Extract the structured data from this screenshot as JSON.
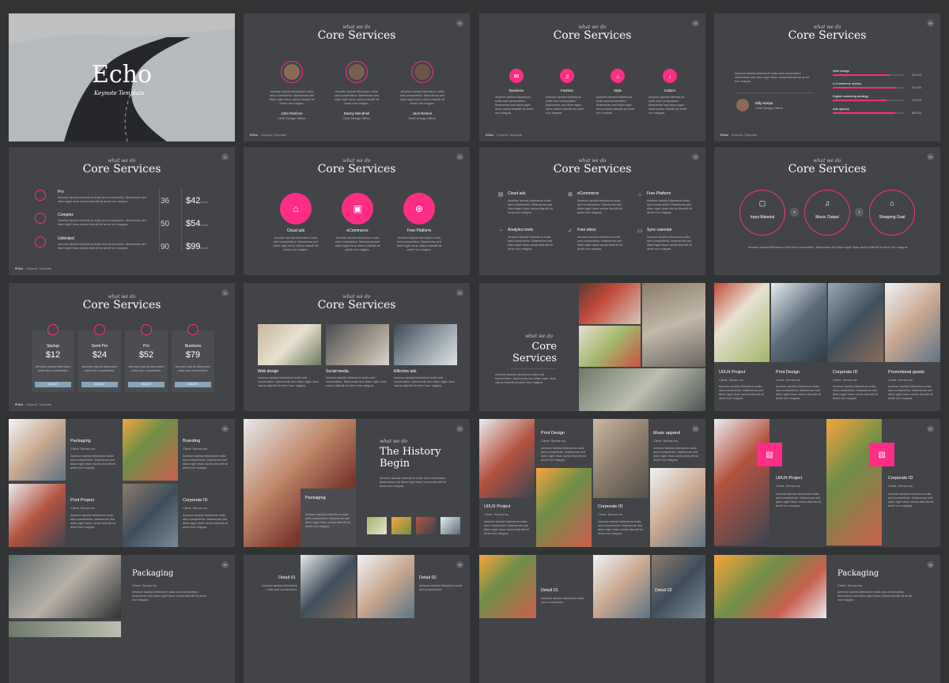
{
  "common": {
    "kicker": "what we do",
    "core_services": "Core Services",
    "footer_brand": "Echo",
    "footer_sub": "Keynote Template",
    "lorem": "Aenean lacinia bibendum nulla sed consectetur. Maecenas sed diam eget risus varius blandit sit amet non magna.",
    "lorem_short": "Aenean lacinia bibendum nulla sed consectetur.",
    "client": "Client: Somos inc."
  },
  "s1": {
    "title": "Echo",
    "subtitle": "Keynote Template"
  },
  "s2": {
    "page": "04",
    "people": [
      {
        "name": "John Reslone",
        "role": "Chief Design Officer"
      },
      {
        "name": "Danny Mendhell",
        "role": "Chief Design Officer"
      },
      {
        "name": "Jack Reston",
        "role": "Chief Design Officer"
      }
    ]
  },
  "s3": {
    "page": "05",
    "items": [
      "Business",
      "Fashion",
      "Style",
      "Culture"
    ]
  },
  "s4": {
    "page": "06",
    "person": {
      "name": "Billy Keepe",
      "role": "Chief Design Officer"
    },
    "bars": [
      {
        "label": "Web design",
        "value": "80/100",
        "level": 0.8
      },
      {
        "label": "e-Commerce startup",
        "value": "90/100",
        "level": 0.9
      },
      {
        "label": "Digital marketing strategy",
        "value": "75/100",
        "level": 0.75
      },
      {
        "label": "Ads agency",
        "value": "88/100",
        "level": 0.88
      }
    ]
  },
  "s5": {
    "page": "11",
    "plans": [
      {
        "name": "Pro",
        "users": "36",
        "price": "$42",
        "unit": "month"
      },
      {
        "name": "Complex",
        "users": "50",
        "price": "$54",
        "unit": "month"
      },
      {
        "name": "Unlimited",
        "users": "90",
        "price": "$99",
        "unit": "month"
      }
    ]
  },
  "s6": {
    "page": "13",
    "items": [
      "Cloud ads",
      "eCommerce",
      "Free Platform"
    ]
  },
  "s7": {
    "page": "12",
    "items": [
      "Cloud ads",
      "eCommerce",
      "Free Platform",
      "Analytics tools",
      "Free inbox",
      "Sync calendar"
    ]
  },
  "s8": {
    "page": "09",
    "items": [
      "Input Material",
      "Music Output",
      "Shopping Goal"
    ]
  },
  "s9": {
    "page": "14",
    "plans": [
      {
        "name": "Startup",
        "price": "$12"
      },
      {
        "name": "Semi Pro",
        "price": "$24"
      },
      {
        "name": "Pro",
        "price": "$52"
      },
      {
        "name": "Business",
        "price": "$79"
      }
    ],
    "button": "SELECT"
  },
  "s10": {
    "page": "20",
    "items": [
      "Web design",
      "Social media",
      "Effective ads"
    ]
  },
  "s11": {
    "page": "21",
    "title_line1": "Core",
    "title_line2": "Services"
  },
  "s12": {
    "items": [
      "UI/UX Project",
      "Print Design",
      "Corporate ID",
      "Promotional goods"
    ]
  },
  "s13": {
    "page": "33",
    "items": [
      "Packaging",
      "Branding",
      "Print Project",
      "Corporate ID"
    ]
  },
  "s14": {
    "page": "22",
    "title_line1": "The History",
    "title_line2": "Begin",
    "box": "Packaging"
  },
  "s15": {
    "page": "24",
    "items": [
      "Print Design",
      "Music apparel",
      "UI/UX Project",
      "Corporate ID"
    ]
  },
  "s16": {
    "page": "23",
    "items": [
      "UI/UX Project",
      "Corporate ID"
    ]
  },
  "s17": {
    "page": "34",
    "title": "Packaging"
  },
  "s18": {
    "page": "35",
    "items": [
      "Detail 01",
      "Detail 02"
    ]
  },
  "s19": {
    "items": [
      "Detail 01",
      "Detail 02"
    ]
  },
  "s20": {
    "page": "36",
    "title": "Packaging"
  },
  "colors": {
    "accent": "#ff2d86",
    "slide_bg": "#424448",
    "page_bg": "#323335"
  }
}
